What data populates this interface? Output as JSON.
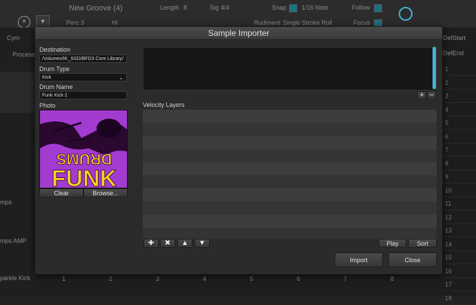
{
  "background": {
    "groove_name": "New Groove (4)",
    "length_label": "Length",
    "length_value": "8",
    "sig_label": "Sig",
    "sig_value": "4/4",
    "snap_label": "Snap",
    "snap_value": "1/16 Note",
    "follow_label": "Follow",
    "perc_label": "Perc 3",
    "hi_label": "Hi",
    "rudiment_label": "Rudiment",
    "rudiment_value": "Single Stroke Roll",
    "focus_label": "Focus",
    "cym_label": "Cym",
    "process_label": "Process",
    "left_item_1": "mps",
    "left_item_2": "mps AMP",
    "left_item_3": "parkle Kick",
    "right_def": "Def.",
    "right_start": "Start",
    "right_end": "End",
    "right_rows": [
      "1",
      "2",
      "3",
      "4",
      "5",
      "6",
      "7",
      "8",
      "9",
      "10",
      "11",
      "12",
      "13",
      "14",
      "15",
      "16",
      "17",
      "18"
    ],
    "ruler": [
      "1",
      "2",
      "3",
      "4",
      "5",
      "6",
      "7",
      "8"
    ]
  },
  "dialog": {
    "title": "Sample Importer",
    "destination_label": "Destination",
    "destination_value": "/Volumes/IK_SSD/BFD3 Core Library/",
    "drum_type_label": "Drum Type",
    "drum_type_value": "Kick",
    "drum_name_label": "Drum Name",
    "drum_name_value": "Funk Kick 2",
    "photo_label": "Photo",
    "photo_text_top": "DRUMS",
    "photo_text_bottom": "FUNK",
    "clear_label": "Clear",
    "browse_label": "Browse...",
    "velocity_layers_label": "Velocity Layers",
    "play_label": "Play",
    "sort_label": "Sort",
    "import_label": "Import",
    "close_label": "Close"
  },
  "colors": {
    "accent": "#48b3d6",
    "photo_bg": "#a43bd1",
    "photo_text": "#f5d31c"
  },
  "icons": [
    "add-icon",
    "remove-icon",
    "move-up-icon",
    "move-down-icon",
    "plus-icon",
    "minus-icon"
  ]
}
